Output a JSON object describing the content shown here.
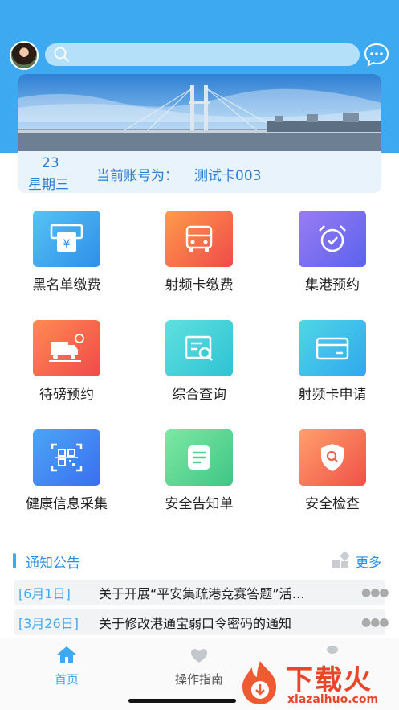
{
  "header": {
    "search": {
      "placeholder": "",
      "value": ""
    },
    "brand_color": "#3da9f0"
  },
  "banner": {
    "day": "23",
    "weekday": "星期三",
    "account_label": "当前账号为：",
    "account_value": "测试卡003"
  },
  "grid": {
    "items": [
      {
        "label": "黑名单缴费",
        "icon": "yen-card-icon",
        "color": "#3aa6ee"
      },
      {
        "label": "射频卡缴费",
        "icon": "truck-front-icon",
        "color": "#f05a4a"
      },
      {
        "label": "集港预约",
        "icon": "alarm-clock-icon",
        "color": "#6b6af0"
      },
      {
        "label": "待磅预约",
        "icon": "truck-scale-icon",
        "color": "#f05a4a"
      },
      {
        "label": "综合查询",
        "icon": "document-search-icon",
        "color": "#3fd0d6"
      },
      {
        "label": "射频卡申请",
        "icon": "card-icon",
        "color": "#3aa6ee"
      },
      {
        "label": "健康信息采集",
        "icon": "qr-code-icon",
        "color": "#3a80f0"
      },
      {
        "label": "安全告知单",
        "icon": "note-icon",
        "color": "#4cd38e"
      },
      {
        "label": "安全检查",
        "icon": "shield-search-icon",
        "color": "#f05a4a"
      }
    ]
  },
  "notice": {
    "title": "通知公告",
    "more": "更多",
    "items": [
      {
        "date": "[6月1日]",
        "text": "关于开展“平安集疏港竞赛答题”活…"
      },
      {
        "date": "[3月26日]",
        "text": "关于修改港通宝弱口令密码的通知"
      }
    ]
  },
  "tabbar": {
    "home": "首页",
    "guide": "操作指南"
  },
  "watermark": {
    "text": "下载火",
    "sub": "xiazaihuo.com"
  }
}
